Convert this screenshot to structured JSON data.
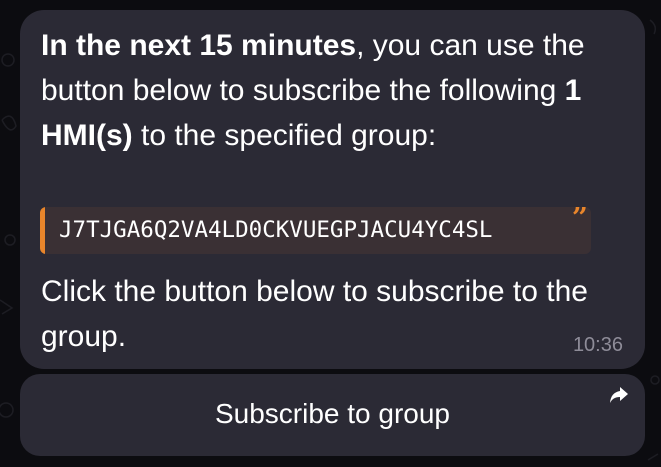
{
  "message": {
    "intro_bold": "In the next 15 minutes",
    "intro_rest": ", you can use the button below to subscribe the following ",
    "count_bold": "1 HMI(s)",
    "intro_end": " to the specified group:",
    "code": "J7TJGA6Q2VA4LD0CKVUEGPJACU4YC4SL",
    "quote_mark": "”",
    "instruction": "Click the button below to subscribe to the group.",
    "time": "10:36"
  },
  "button": {
    "label": "Subscribe to group",
    "icon": "share-arrow-icon"
  },
  "colors": {
    "bubble": "#2b2a35",
    "accent": "#e8852b",
    "quote_bg": "#3a3034",
    "timestamp": "#8e8c98"
  }
}
